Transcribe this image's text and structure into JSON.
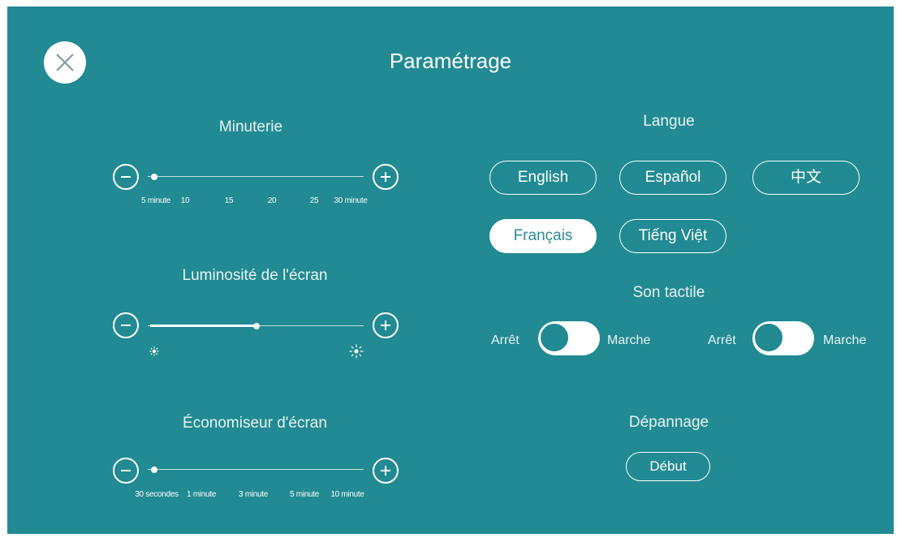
{
  "title": "Paramétrage",
  "close_icon": "close-icon",
  "timer": {
    "title": "Minuterie",
    "ticks": [
      "5 minute",
      "10",
      "15",
      "20",
      "25",
      "30 minute"
    ],
    "value": "5 minute"
  },
  "brightness": {
    "title": "Luminosité de l'écran",
    "level_fraction": 0.5,
    "low_icon": "dim-sun-icon",
    "high_icon": "bright-sun-icon"
  },
  "screensaver": {
    "title": "Économiseur d'écran",
    "ticks": [
      "30 secondes",
      "1 minute",
      "3 minute",
      "5 minute",
      "10 minute"
    ],
    "value": "30 secondes"
  },
  "language": {
    "title": "Langue",
    "options": [
      "English",
      "Español",
      "中文",
      "Français",
      "Tiếng Việt"
    ],
    "selected": "Français"
  },
  "touch_sound": {
    "title": "Son tactile",
    "toggles": [
      {
        "off_label": "Arrêt",
        "on_label": "Marche",
        "state": "Arrêt"
      },
      {
        "off_label": "Arrêt",
        "on_label": "Marche",
        "state": "Arrêt"
      }
    ]
  },
  "troubleshooting": {
    "title": "Dépannage",
    "button_label": "Début"
  },
  "colors": {
    "background": "#218a92",
    "foreground": "#ffffff"
  }
}
